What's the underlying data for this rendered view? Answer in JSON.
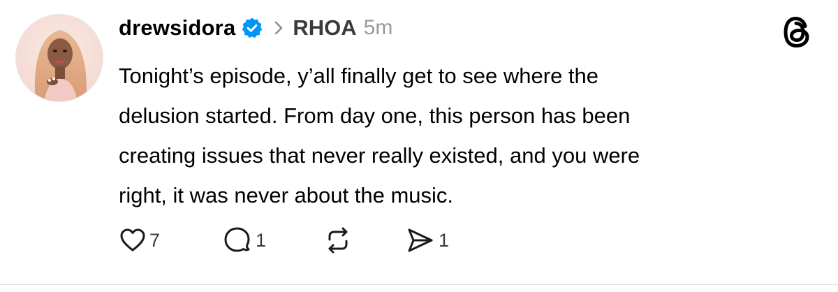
{
  "post": {
    "username": "drewsidora",
    "verified": true,
    "community": "RHOA",
    "time": "5m",
    "text_lines": [
      "Tonight’s episode, y’all finally get to see where the",
      "delusion started. From day one, this person has been",
      "creating issues that never really existed, and you were",
      "right, it was never about the music."
    ]
  },
  "actions": {
    "like_count": "7",
    "reply_count": "1",
    "share_count": "1"
  },
  "icons": {
    "verified": "verified-badge-icon",
    "chevron": "chevron-right-icon",
    "app_logo": "threads-logo-icon",
    "like": "heart-icon",
    "reply": "comment-bubble-icon",
    "repost": "repost-icon",
    "share": "send-icon"
  },
  "colors": {
    "verified_blue": "#0095f6",
    "text": "#000000",
    "secondary": "#9a9a9a"
  }
}
